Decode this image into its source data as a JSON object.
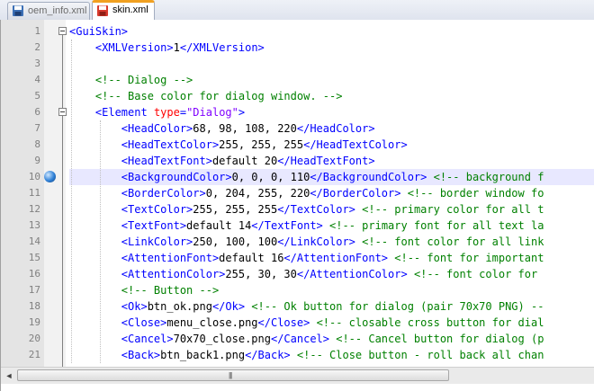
{
  "tabs": [
    {
      "label": "oem_info.xml",
      "active": false,
      "icon": "floppy-disk-icon"
    },
    {
      "label": "skin.xml",
      "active": true,
      "icon": "unsaved-file-icon"
    }
  ],
  "editor": {
    "current_line": 10,
    "lines": [
      {
        "n": "1",
        "parts": [
          [
            "tag",
            "<GuiSkin>"
          ]
        ]
      },
      {
        "n": "2",
        "parts": [
          [
            "txt",
            "    "
          ],
          [
            "tag",
            "<XMLVersion>"
          ],
          [
            "txt",
            "1"
          ],
          [
            "tag",
            "</XMLVersion>"
          ]
        ]
      },
      {
        "n": "3",
        "parts": []
      },
      {
        "n": "4",
        "parts": [
          [
            "txt",
            "    "
          ],
          [
            "cmt",
            "<!-- Dialog -->"
          ]
        ]
      },
      {
        "n": "5",
        "parts": [
          [
            "txt",
            "    "
          ],
          [
            "cmt",
            "<!-- Base color for dialog window. -->"
          ]
        ]
      },
      {
        "n": "6",
        "parts": [
          [
            "txt",
            "    "
          ],
          [
            "tag",
            "<Element "
          ],
          [
            "attr",
            "type"
          ],
          [
            "tag",
            "="
          ],
          [
            "val",
            "\"Dialog\""
          ],
          [
            "tag",
            ">"
          ]
        ]
      },
      {
        "n": "7",
        "parts": [
          [
            "txt",
            "        "
          ],
          [
            "tag",
            "<HeadColor>"
          ],
          [
            "txt",
            "68, 98, 108, 220"
          ],
          [
            "tag",
            "</HeadColor>"
          ]
        ]
      },
      {
        "n": "8",
        "parts": [
          [
            "txt",
            "        "
          ],
          [
            "tag",
            "<HeadTextColor>"
          ],
          [
            "txt",
            "255, 255, 255"
          ],
          [
            "tag",
            "</HeadTextColor>"
          ]
        ]
      },
      {
        "n": "9",
        "parts": [
          [
            "txt",
            "        "
          ],
          [
            "tag",
            "<HeadTextFont>"
          ],
          [
            "txt",
            "default 20"
          ],
          [
            "tag",
            "</HeadTextFont>"
          ]
        ]
      },
      {
        "n": "10",
        "parts": [
          [
            "txt",
            "        "
          ],
          [
            "tag",
            "<BackgroundColor>"
          ],
          [
            "txt",
            "0, 0, 0, 110"
          ],
          [
            "tag",
            "</BackgroundColor>"
          ],
          [
            "txt",
            " "
          ],
          [
            "cmt",
            "<!-- background f"
          ]
        ]
      },
      {
        "n": "11",
        "parts": [
          [
            "txt",
            "        "
          ],
          [
            "tag",
            "<BorderColor>"
          ],
          [
            "txt",
            "0, 204, 255, 220"
          ],
          [
            "tag",
            "</BorderColor>"
          ],
          [
            "txt",
            " "
          ],
          [
            "cmt",
            "<!-- border window fo"
          ]
        ]
      },
      {
        "n": "12",
        "parts": [
          [
            "txt",
            "        "
          ],
          [
            "tag",
            "<TextColor>"
          ],
          [
            "txt",
            "255, 255, 255"
          ],
          [
            "tag",
            "</TextColor>"
          ],
          [
            "txt",
            " "
          ],
          [
            "cmt",
            "<!-- primary color for all t"
          ]
        ]
      },
      {
        "n": "13",
        "parts": [
          [
            "txt",
            "        "
          ],
          [
            "tag",
            "<TextFont>"
          ],
          [
            "txt",
            "default 14"
          ],
          [
            "tag",
            "</TextFont>"
          ],
          [
            "txt",
            " "
          ],
          [
            "cmt",
            "<!-- primary font for all text la"
          ]
        ]
      },
      {
        "n": "14",
        "parts": [
          [
            "txt",
            "        "
          ],
          [
            "tag",
            "<LinkColor>"
          ],
          [
            "txt",
            "250, 100, 100"
          ],
          [
            "tag",
            "</LinkColor>"
          ],
          [
            "txt",
            " "
          ],
          [
            "cmt",
            "<!-- font color for all link"
          ]
        ]
      },
      {
        "n": "15",
        "parts": [
          [
            "txt",
            "        "
          ],
          [
            "tag",
            "<AttentionFont>"
          ],
          [
            "txt",
            "default 16"
          ],
          [
            "tag",
            "</AttentionFont>"
          ],
          [
            "txt",
            " "
          ],
          [
            "cmt",
            "<!-- font for important"
          ]
        ]
      },
      {
        "n": "16",
        "parts": [
          [
            "txt",
            "        "
          ],
          [
            "tag",
            "<AttentionColor>"
          ],
          [
            "txt",
            "255, 30, 30"
          ],
          [
            "tag",
            "</AttentionColor>"
          ],
          [
            "txt",
            " "
          ],
          [
            "cmt",
            "<!-- font color for"
          ]
        ]
      },
      {
        "n": "17",
        "parts": [
          [
            "txt",
            "        "
          ],
          [
            "cmt",
            "<!-- Button -->"
          ]
        ]
      },
      {
        "n": "18",
        "parts": [
          [
            "txt",
            "        "
          ],
          [
            "tag",
            "<Ok>"
          ],
          [
            "txt",
            "btn_ok.png"
          ],
          [
            "tag",
            "</Ok>"
          ],
          [
            "txt",
            " "
          ],
          [
            "cmt",
            "<!-- Ok button for dialog (pair 70x70 PNG) --"
          ]
        ]
      },
      {
        "n": "19",
        "parts": [
          [
            "txt",
            "        "
          ],
          [
            "tag",
            "<Close>"
          ],
          [
            "txt",
            "menu_close.png"
          ],
          [
            "tag",
            "</Close>"
          ],
          [
            "txt",
            " "
          ],
          [
            "cmt",
            "<!-- closable cross button for dial"
          ]
        ]
      },
      {
        "n": "20",
        "parts": [
          [
            "txt",
            "        "
          ],
          [
            "tag",
            "<Cancel>"
          ],
          [
            "txt",
            "70x70_close.png"
          ],
          [
            "tag",
            "</Cancel>"
          ],
          [
            "txt",
            " "
          ],
          [
            "cmt",
            "<!-- Cancel button for dialog (p"
          ]
        ]
      },
      {
        "n": "21",
        "parts": [
          [
            "txt",
            "        "
          ],
          [
            "tag",
            "<Back>"
          ],
          [
            "txt",
            "btn_back1.png"
          ],
          [
            "tag",
            "</Back>"
          ],
          [
            "txt",
            " "
          ],
          [
            "cmt",
            "<!-- Close button - roll back all chan"
          ]
        ]
      }
    ]
  },
  "scrollbar": {
    "grip": "|||",
    "left_arrow": "◄",
    "thumb_fraction": 0.75
  },
  "colors": {
    "tag": "#0000ff",
    "attr": "#ff0000",
    "value": "#8000ff",
    "comment": "#008000",
    "active_tab_accent": "#f1a020",
    "current_line": "#e8e8ff"
  }
}
